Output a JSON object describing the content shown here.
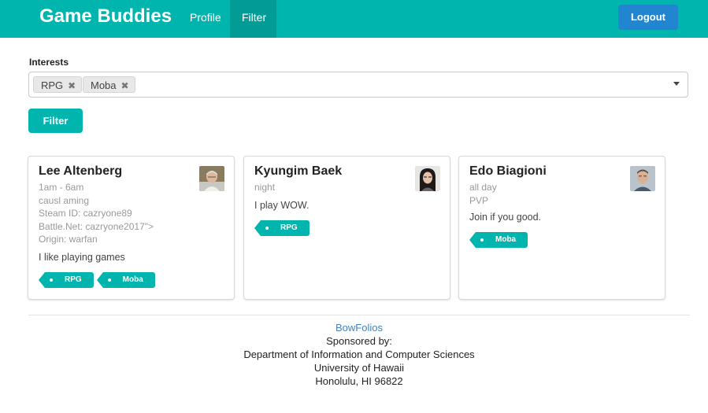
{
  "nav": {
    "brand": "Game Buddies",
    "items": [
      {
        "label": "Profile",
        "active": false
      },
      {
        "label": "Filter",
        "active": true
      }
    ],
    "logout_label": "Logout",
    "colors": {
      "bar": "#00b5ad",
      "active": "#009c95",
      "logout": "#2185d0"
    }
  },
  "filter_form": {
    "label": "Interests",
    "selected": [
      "RPG",
      "Moba"
    ],
    "remove_icon": "close-icon",
    "dropdown_icon": "caret-down-icon",
    "button_label": "Filter"
  },
  "profiles": [
    {
      "name": "Lee Altenberg",
      "meta": [
        "1am - 6am",
        "causl aming",
        "Steam ID: cazryone89",
        "Battle.Net: cazryone2017\">",
        "Origin: warfan"
      ],
      "description": "I like playing games",
      "tags": [
        "RPG",
        "Moba"
      ]
    },
    {
      "name": "Kyungim Baek",
      "meta": [
        "night"
      ],
      "description": "I play WOW.",
      "tags": [
        "RPG"
      ]
    },
    {
      "name": "Edo Biagioni",
      "meta": [
        "all day",
        "PVP"
      ],
      "description": "Join if you good.",
      "tags": [
        "Moba"
      ]
    }
  ],
  "footer": {
    "link": "BowFolios",
    "lines": [
      "Sponsored by:",
      "Department of Information and Computer Sciences",
      "University of Hawaii",
      "Honolulu, HI 96822"
    ]
  }
}
